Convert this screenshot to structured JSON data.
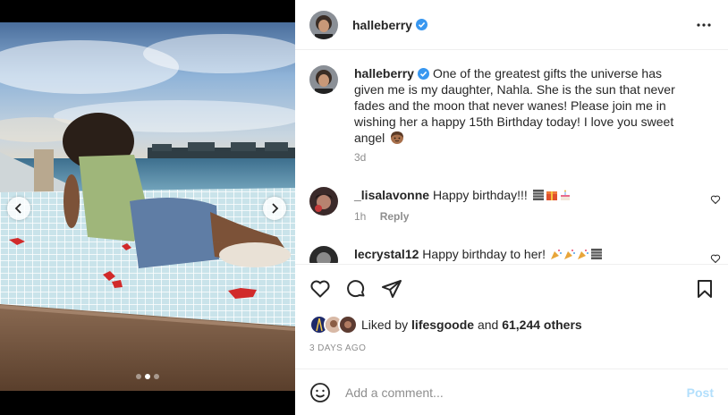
{
  "post": {
    "author": "halleberry",
    "verified": true,
    "caption": "One of the greatest gifts the universe has given me is my daughter, Nahla. She is the sun that never fades and the moon that never wanes! Please join me in wishing her a happy 15th Birthday today! I love you sweet angel",
    "caption_emoji": "woman-face-emoji",
    "age": "3d",
    "timestamp": "3 DAYS AGO"
  },
  "carousel": {
    "slides": 3,
    "active_slide": 2
  },
  "comments": [
    {
      "user": "_lisalavonne",
      "text": "Happy birthday!!!",
      "emojis": [
        "books-emoji",
        "gift-emoji",
        "cake-emoji"
      ],
      "age": "1h",
      "reply_label": "Reply"
    },
    {
      "user": "lecrystal12",
      "text": "Happy birthday to her!",
      "emojis": [
        "party-popper-emoji",
        "party-popper-emoji",
        "party-popper-emoji",
        "books-emoji"
      ]
    }
  ],
  "likes": {
    "prefix": "Liked by",
    "first_liker": "lifesgoode",
    "connector": "and",
    "others": "61,244 others"
  },
  "composer": {
    "placeholder": "Add a comment...",
    "post_label": "Post"
  },
  "colors": {
    "verified": "#3897f0",
    "post_disabled": "#b2dffc",
    "meta_gray": "#8e8e8e",
    "text": "#262626"
  }
}
